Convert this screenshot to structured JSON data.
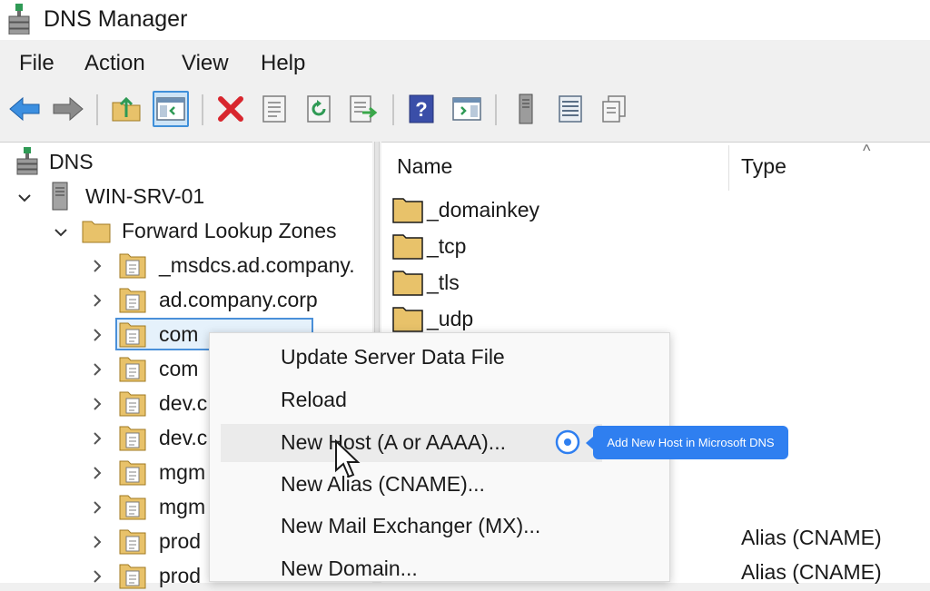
{
  "window": {
    "title": "DNS Manager"
  },
  "menu": [
    "File",
    "Action",
    "View",
    "Help"
  ],
  "toolbar": {
    "icons": [
      "back-arrow-icon",
      "forward-arrow-icon",
      "up-folder-icon",
      "console-tree-icon",
      "delete-icon",
      "properties-icon",
      "refresh-icon",
      "export-list-icon",
      "help-icon",
      "action-pane-icon",
      "server-icon",
      "list-icon",
      "copy-icon"
    ]
  },
  "tree": {
    "root": "DNS",
    "server": "WIN-SRV-01",
    "forward_zones": "Forward Lookup Zones",
    "zones": [
      "_msdcs.ad.company.",
      "ad.company.corp",
      "com",
      "com",
      "dev.c",
      "dev.c",
      "mgm",
      "mgm",
      "prod",
      "prod"
    ]
  },
  "list": {
    "headers": {
      "name": "Name",
      "type": "Type"
    },
    "rows": [
      {
        "name": "_domainkey",
        "type": ""
      },
      {
        "name": "_tcp",
        "type": ""
      },
      {
        "name": "_tls",
        "type": ""
      },
      {
        "name": "_udp",
        "type": ""
      }
    ],
    "visible_types": [
      "Alias (CNAME)",
      "Alias (CNAME)"
    ]
  },
  "context_menu": {
    "items": [
      "Update Server Data File",
      "Reload",
      "New Host (A or AAAA)...",
      "New Alias (CNAME)...",
      "New Mail Exchanger (MX)...",
      "New Domain..."
    ],
    "highlighted_index": 2
  },
  "tooltip": {
    "text": "Add New Host in Microsoft DNS"
  },
  "colors": {
    "selection_border": "#4a90d9",
    "tooltip_bg": "#2f7ff0",
    "folder": "#e8c26a"
  }
}
